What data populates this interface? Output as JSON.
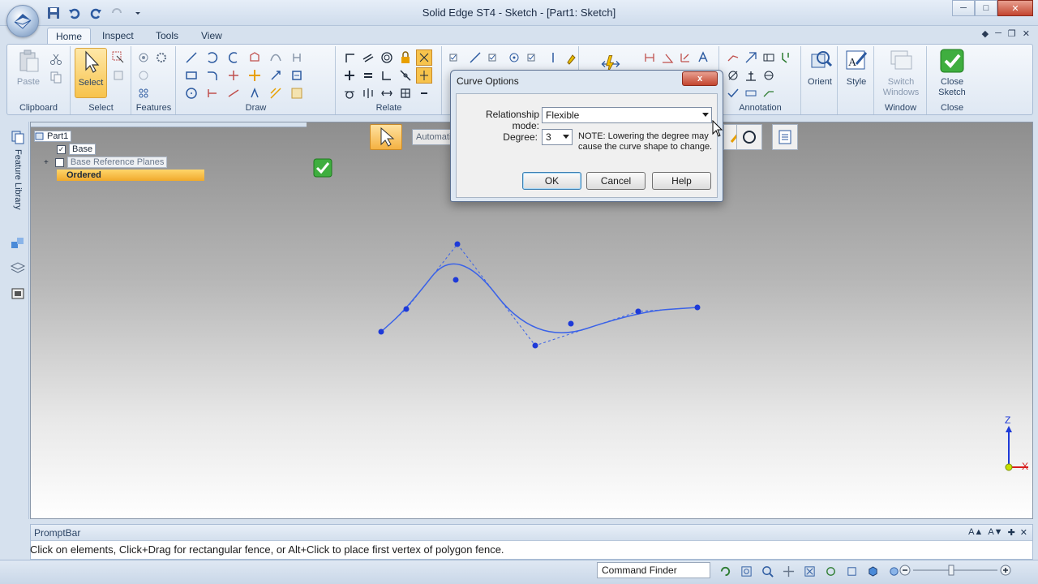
{
  "window": {
    "title": "Solid Edge ST4 - Sketch - [Part1: Sketch]",
    "controls": [
      "minimize",
      "maximize",
      "close"
    ]
  },
  "tabs": [
    {
      "label": "Home",
      "active": true
    },
    {
      "label": "Inspect",
      "active": false
    },
    {
      "label": "Tools",
      "active": false
    },
    {
      "label": "View",
      "active": false
    }
  ],
  "ribbon": {
    "groups": {
      "clipboard": "Clipboard",
      "select": "Select",
      "features": "Features",
      "draw": "Draw",
      "relate": "Relate",
      "annotation": "Annotation",
      "window": "Window",
      "close": "Close"
    },
    "buttons": {
      "paste": "Paste",
      "select": "Select",
      "orient": "Orient",
      "style": "Style",
      "switch_windows": "Switch Windows",
      "close_sketch": "Close Sketch"
    }
  },
  "sidebar": {
    "feature_library": "Feature Library"
  },
  "pathfinder": {
    "root": "Part1",
    "items": [
      {
        "label": "Base",
        "checked": true
      },
      {
        "label": "Base Reference Planes",
        "checked": false
      },
      {
        "label": "Ordered",
        "highlighted": true
      }
    ]
  },
  "commandbar": {
    "mode_field": "Automati"
  },
  "dialog": {
    "title": "Curve Options",
    "close_glyph": "x",
    "relationship_label": "Relationship mode:",
    "relationship_value": "Flexible",
    "degree_label": "Degree:",
    "degree_value": "3",
    "note": "NOTE:  Lowering the degree may cause the curve shape to change.",
    "ok": "OK",
    "cancel": "Cancel",
    "help": "Help"
  },
  "curve": {
    "color": "#3a62e8",
    "control_points": [
      [
        469,
        408
      ],
      [
        500,
        380
      ],
      [
        563,
        300
      ],
      [
        659,
        425
      ],
      [
        786,
        383
      ],
      [
        859,
        378
      ]
    ],
    "curve_points": [
      [
        561,
        344
      ],
      [
        703,
        398
      ],
      [
        786,
        383
      ]
    ]
  },
  "triad": {
    "z_label": "Z",
    "x_label": "X"
  },
  "promptbar": {
    "title": "PromptBar",
    "message": "Click on elements, Click+Drag for rectangular fence, or Alt+Click to place first vertex of polygon fence."
  },
  "statusbar": {
    "command_finder": "Command Finder"
  }
}
